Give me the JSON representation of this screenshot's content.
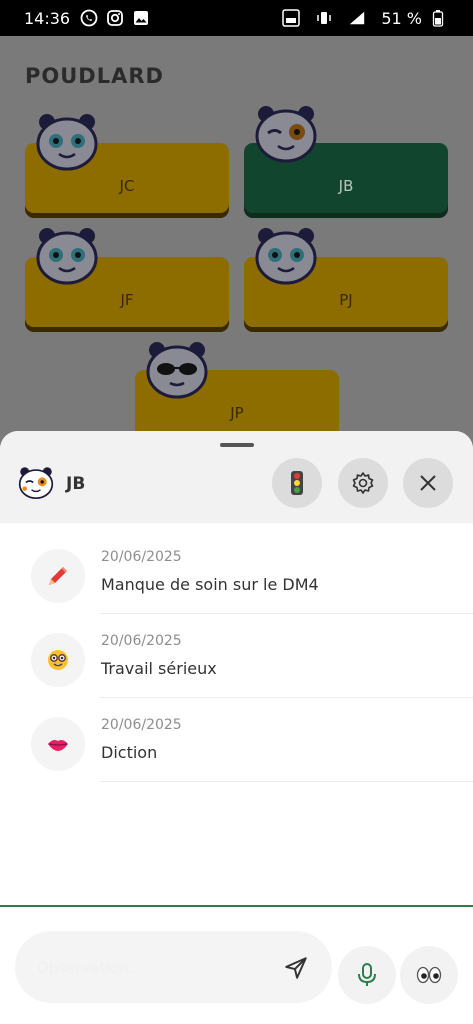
{
  "status_bar": {
    "time": "14:36",
    "battery": "51 %"
  },
  "app": {
    "title": "POUDLARD",
    "students": [
      {
        "initials": "JC",
        "color": "yellow"
      },
      {
        "initials": "JB",
        "color": "green"
      },
      {
        "initials": "JF",
        "color": "yellow"
      },
      {
        "initials": "PJ",
        "color": "yellow"
      },
      {
        "initials": "JP",
        "color": "yellow"
      }
    ]
  },
  "sheet": {
    "student_name": "JB",
    "items": [
      {
        "date": "20/06/2025",
        "text": "Manque de soin sur le DM4",
        "icon": "pencil-icon"
      },
      {
        "date": "20/06/2025",
        "text": "Travail sérieux",
        "icon": "nerd-face-icon"
      },
      {
        "date": "20/06/2025",
        "text": "Diction",
        "icon": "lips-icon"
      }
    ],
    "input_placeholder": "Observation..."
  },
  "colors": {
    "accent_green": "#2e7d4f",
    "card_yellow": "#8d6c00",
    "card_green": "#12452d"
  }
}
